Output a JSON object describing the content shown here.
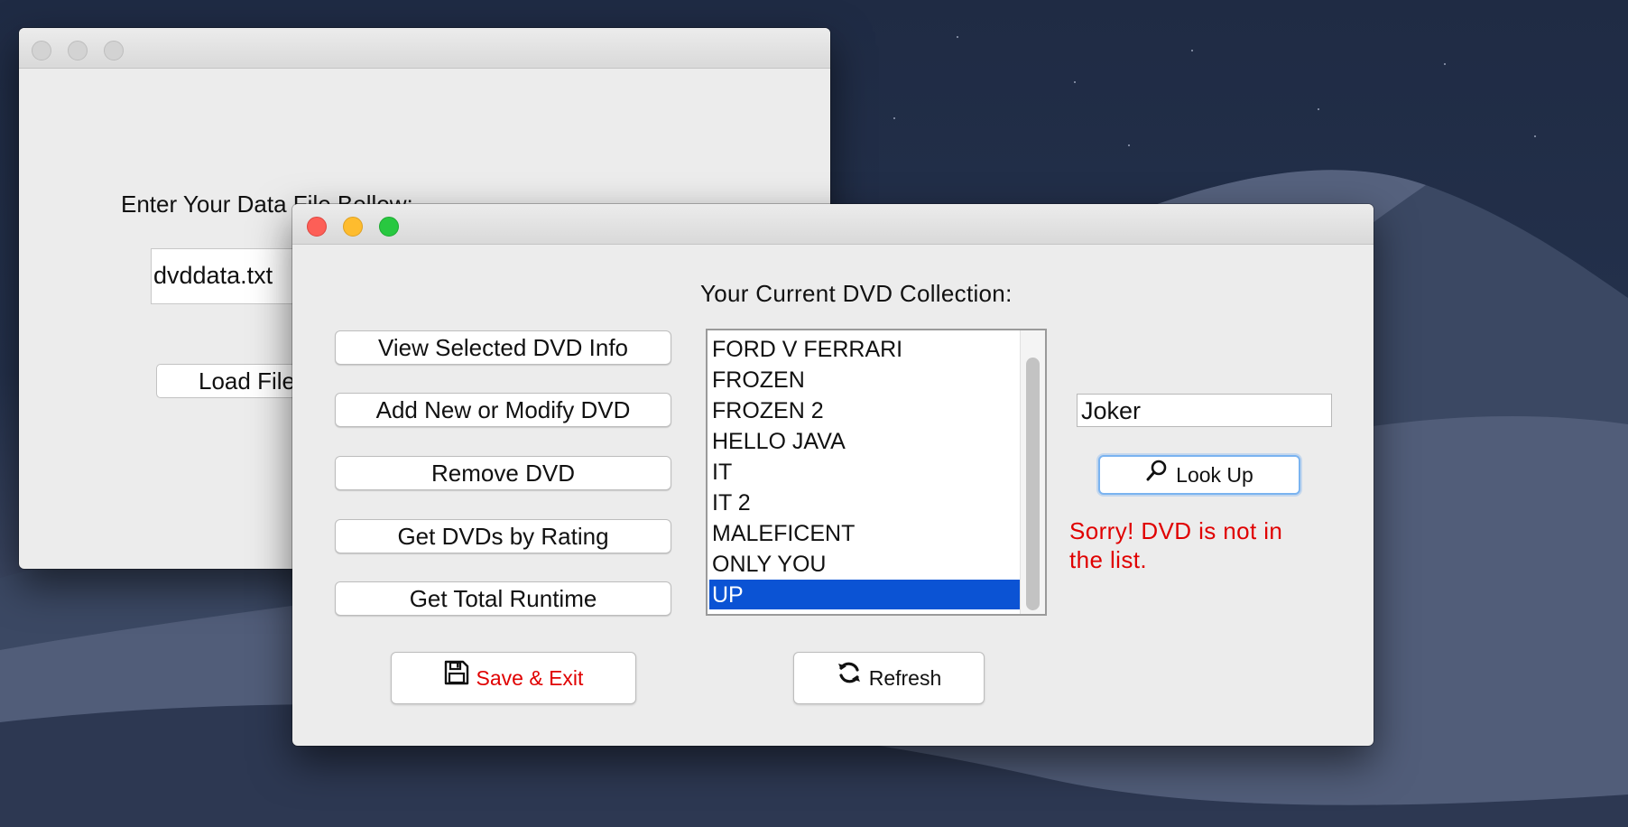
{
  "back_window": {
    "label": "Enter Your Data File Bellow:",
    "file_input_value": "dvddata.txt",
    "load_button_label": "Load File"
  },
  "main_window": {
    "collection_title": "Your Current DVD Collection:",
    "side_buttons": [
      "View Selected DVD Info",
      "Add New or Modify DVD",
      "Remove DVD",
      "Get DVDs by Rating",
      "Get Total Runtime"
    ],
    "dvd_list": [
      "FORD V FERRARI",
      "FROZEN",
      "FROZEN 2",
      "HELLO JAVA",
      "IT",
      "IT 2",
      "MALEFICENT",
      "ONLY YOU",
      "UP"
    ],
    "selected_item": "UP",
    "lookup_input_value": "Joker",
    "lookup_button_label": "Look Up",
    "error_message": "Sorry! DVD is not in the list.",
    "save_button_label": "Save & Exit",
    "refresh_button_label": "Refresh"
  },
  "colors": {
    "selection": "#0b53d4",
    "error_text": "#e00000",
    "lookup_focus": "#7ab3f0"
  },
  "icons": {
    "lookup": "magnifier-icon",
    "save": "floppy-disk-icon",
    "refresh": "refresh-icon"
  }
}
